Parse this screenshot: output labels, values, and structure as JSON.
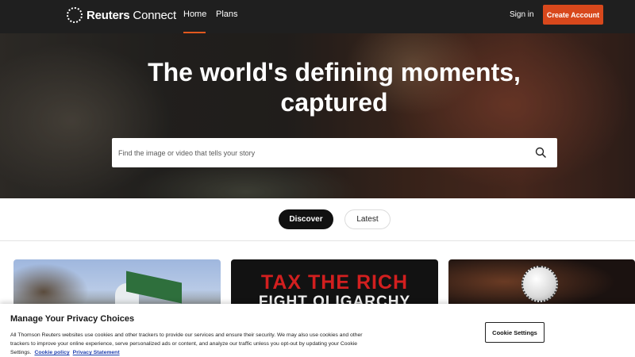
{
  "header": {
    "brand": {
      "bold": "Reuters",
      "light": " Connect"
    },
    "nav": [
      {
        "label": "Home",
        "active": true
      },
      {
        "label": "Plans",
        "active": false
      }
    ],
    "sign_in_label": "Sign in",
    "create_account_label": "Create Account",
    "accent_color": "#d8481c"
  },
  "hero": {
    "title_line1": "The world's defining moments,",
    "title_line2": "captured",
    "search_placeholder": "Find the image or video that tells your story",
    "search_icon": "search-icon"
  },
  "tabs": [
    {
      "label": "Discover",
      "selected": true
    },
    {
      "label": "Latest",
      "selected": false
    }
  ],
  "cards": {
    "card2_text_line1": "TAX THE RICH",
    "card2_text_line2": "FIGHT OLIGARCHY"
  },
  "privacy": {
    "title": "Manage Your Privacy Choices",
    "body": "All Thomson Reuters websites use cookies and other trackers to provide our services and ensure their security. We may also use cookies and other trackers to improve your online experience, serve personalized ads or content, and analyze our traffic unless you opt-out by updating your Cookie Settings.",
    "cookie_policy_label": "Cookie policy",
    "privacy_statement_label": "Privacy Statement",
    "cookie_settings_label": "Cookie Settings"
  }
}
